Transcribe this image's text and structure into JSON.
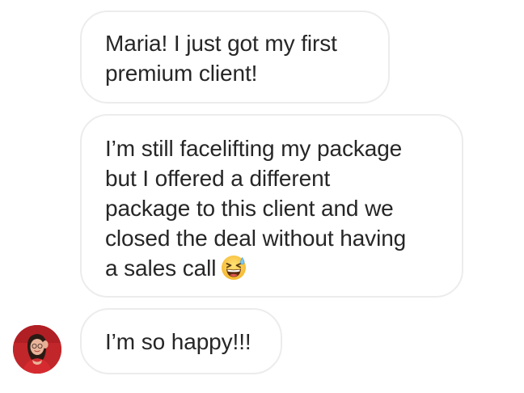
{
  "conversation": {
    "messages": [
      {
        "lines": [
          "Maria! I just got my first",
          "premium client!"
        ]
      },
      {
        "lines": [
          "I’m still facelifting my package",
          "but I offered a different",
          "package to this client and we",
          "closed the deal without having",
          "a sales call"
        ],
        "trailing_emoji": "grinning-squinting-face-with-sweat-emoji"
      },
      {
        "lines": [
          "I’m so happy!!!"
        ]
      }
    ],
    "sender": {
      "avatar_icon": "profile-photo-avatar"
    }
  },
  "colors": {
    "bubble_border": "#ececec",
    "text": "#262626",
    "avatar_background": "#c1262a"
  }
}
